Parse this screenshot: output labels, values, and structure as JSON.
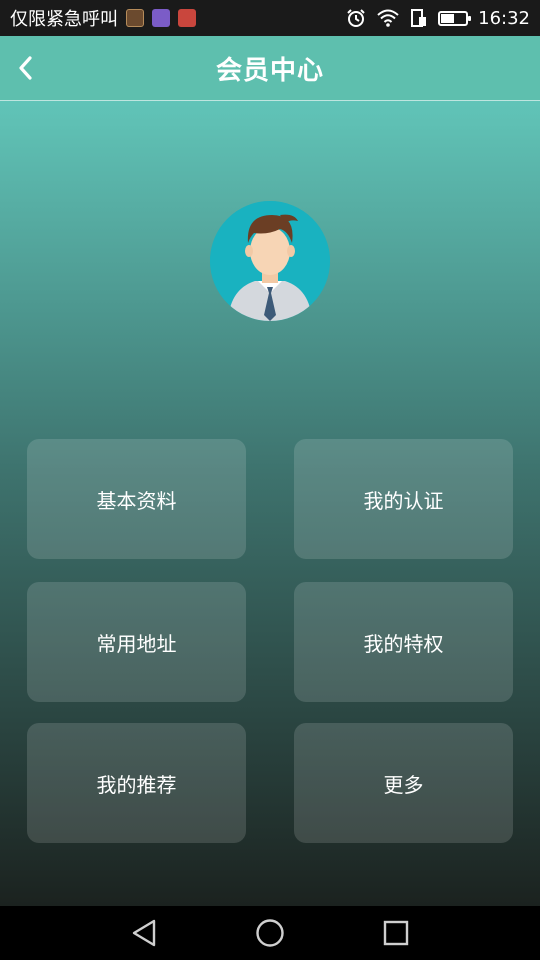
{
  "status_bar": {
    "carrier_text": "仅限紧急呼叫",
    "time": "16:32",
    "battery_level": 0.5,
    "icons": [
      "picture-notification-icon",
      "gallery-notification-icon",
      "app-notification-icon",
      "alarm-icon",
      "wifi-icon",
      "sim-icon",
      "battery-icon"
    ]
  },
  "header": {
    "title": "会员中心",
    "back_icon": "chevron-left-icon"
  },
  "colors": {
    "header_bg": "#5ebfae",
    "gradient_top": "#62cec2",
    "gradient_bottom": "#1b221f",
    "avatar_bg": "#19b2c0"
  },
  "menu": {
    "items": [
      {
        "label": "基本资料"
      },
      {
        "label": "我的认证"
      },
      {
        "label": "常用地址"
      },
      {
        "label": "我的特权"
      },
      {
        "label": "我的推荐"
      },
      {
        "label": "更多"
      }
    ]
  },
  "nav_bar": {
    "icons": [
      "back-triangle-icon",
      "home-circle-icon",
      "recents-square-icon"
    ]
  }
}
